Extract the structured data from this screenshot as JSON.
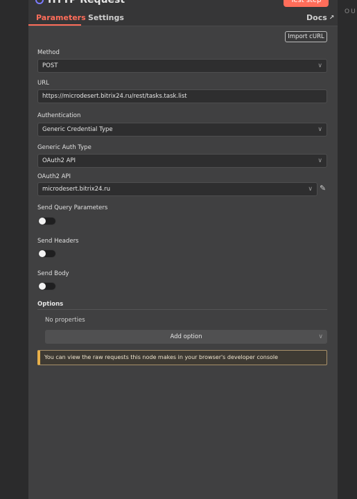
{
  "header": {
    "title": "HTTP Request",
    "test_step_label": "Test step",
    "tabs": [
      {
        "label": "Parameters",
        "active": true
      },
      {
        "label": "Settings",
        "active": false
      }
    ],
    "docs_label": "Docs"
  },
  "import_curl_label": "Import cURL",
  "fields": {
    "method": {
      "label": "Method",
      "value": "POST"
    },
    "url": {
      "label": "URL",
      "value": "https://microdesert.bitrix24.ru/rest/tasks.task.list"
    },
    "authentication": {
      "label": "Authentication",
      "value": "Generic Credential Type"
    },
    "generic_auth_type": {
      "label": "Generic Auth Type",
      "value": "OAuth2 API"
    },
    "oauth2_api": {
      "label": "OAuth2 API",
      "value": "microdesert.bitrix24.ru"
    }
  },
  "toggles": {
    "send_query": {
      "label": "Send Query Parameters",
      "on": false
    },
    "send_headers": {
      "label": "Send Headers",
      "on": false
    },
    "send_body": {
      "label": "Send Body",
      "on": false
    }
  },
  "options": {
    "label": "Options",
    "empty_text": "No properties",
    "add_label": "Add option"
  },
  "notice": "You can view the raw requests this node makes in your browser's developer console",
  "output_label": "OU",
  "colors": {
    "accent": "#ff6d5a",
    "panel_bg": "#404041",
    "notice_border": "#e8b04a"
  }
}
